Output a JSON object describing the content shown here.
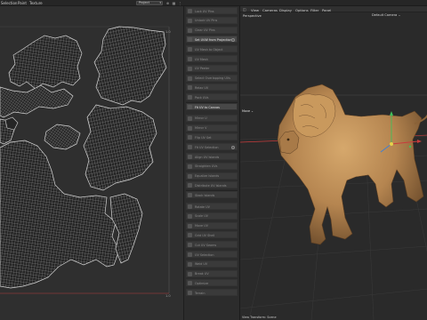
{
  "menubar": {
    "items": [
      "Selection",
      "Paint",
      "Texture"
    ],
    "project": "Project",
    "icons": [
      "dropdown-chevron-icon",
      "lock-icon",
      "grid-icon",
      "more-icon"
    ]
  },
  "uv_editor": {
    "tick_top_right": "1.0",
    "tick_bottom_right": "1.0"
  },
  "tool_menu": {
    "items": [
      {
        "label": "Lock UV Pins",
        "active": false
      },
      {
        "label": "Unlock UV Pins",
        "active": false
      },
      {
        "label": "Clear UV Pins",
        "active": false
      },
      {
        "label": "Set UVW from Projection",
        "active": true,
        "gear": true
      },
      {
        "label": "UV Mesh to Object",
        "active": false
      },
      {
        "label": "UV Mesh",
        "active": false
      },
      {
        "label": "UV Peeler",
        "active": false
      },
      {
        "label": "Select Overlapping UVs",
        "active": false
      },
      {
        "label": "Relax UV",
        "active": false
      },
      {
        "label": "Pack UVs",
        "active": false
      },
      {
        "label": "Fit UV to Canvas",
        "active": true
      },
      {
        "label": "Mirror U",
        "active": false
      },
      {
        "label": "Mirror V",
        "active": false
      },
      {
        "label": "Flip UV Set",
        "active": false
      },
      {
        "label": "Fit UV Selection",
        "active": false,
        "gear": true
      },
      {
        "label": "Align UV Islands",
        "active": false
      },
      {
        "label": "Straighten UVs",
        "active": false
      },
      {
        "label": "Equalize Islands",
        "active": false
      },
      {
        "label": "Distribute UV Islands",
        "active": false
      },
      {
        "label": "Stack Islands",
        "active": false
      },
      {
        "label": "Rotate UV",
        "active": false
      },
      {
        "label": "Scale UV",
        "active": false
      },
      {
        "label": "Move UV",
        "active": false
      },
      {
        "label": "Grid UV Shell",
        "active": false
      },
      {
        "label": "Cut UV Seams",
        "active": false
      },
      {
        "label": "UV Selection",
        "active": false
      },
      {
        "label": "Weld UV",
        "active": false
      },
      {
        "label": "Break UV",
        "active": false
      },
      {
        "label": "Optimize",
        "active": false
      },
      {
        "label": "Terrain",
        "active": false
      }
    ]
  },
  "viewport": {
    "menu": [
      "View",
      "Cameras",
      "Display",
      "Options",
      "Filter",
      "Panel"
    ],
    "label": "Perspective",
    "camera": "Default Camera",
    "move_label": "Move",
    "status": "View Transform: Scene"
  },
  "colors": {
    "uv_fill": "#262626",
    "uv_grid": "#bcbcbc",
    "uv_boundary_accent": "#8a3a3a",
    "lion": "#b98a52",
    "axis_x": "#c83c3c",
    "axis_y": "#3fbf5a",
    "axis_z": "#3c7fd8"
  }
}
